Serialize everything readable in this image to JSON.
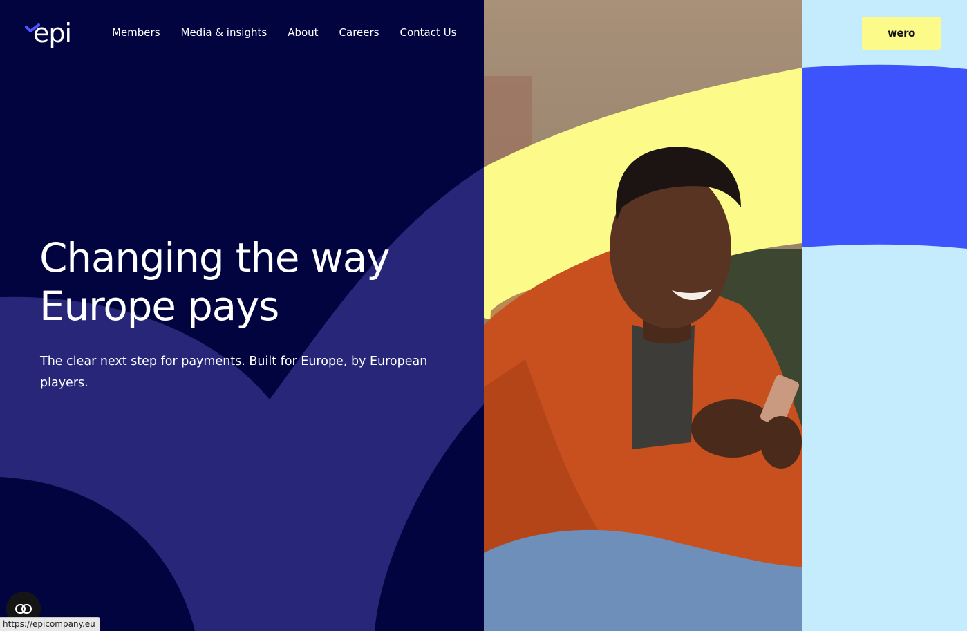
{
  "brand": {
    "logo_text": "epi",
    "logo_icon": "checkmark-icon"
  },
  "nav": {
    "items": [
      {
        "label": "Members"
      },
      {
        "label": "Media & insights"
      },
      {
        "label": "About"
      },
      {
        "label": "Careers"
      },
      {
        "label": "Contact Us"
      }
    ]
  },
  "hero": {
    "headline": "Changing the way Europe pays",
    "subtext": "The clear next step for payments. Built for Europe, by European players."
  },
  "side": {
    "wero_label": "wero"
  },
  "fab": {
    "icon": "link-icon"
  },
  "statusbar": {
    "url": "https://epicompany.eu"
  },
  "colors": {
    "navy": "#02043f",
    "indigo": "#272679",
    "blue": "#3d53fb",
    "yellow": "#fcfb8a",
    "light_blue": "#c4ecfd",
    "orange": "#c8501f"
  }
}
